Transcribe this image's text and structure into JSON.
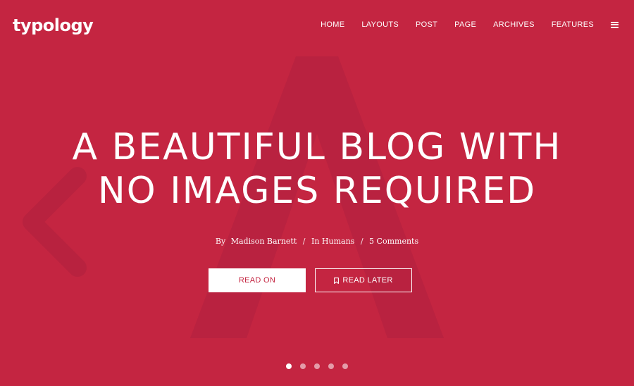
{
  "brand": {
    "logo": "typology",
    "accent_color": "#c42541"
  },
  "nav": {
    "items": [
      "HOME",
      "LAYOUTS",
      "POST",
      "PAGE",
      "ARCHIVES",
      "FEATURES"
    ],
    "menu_icon": "hamburger-icon"
  },
  "hero": {
    "background_letter": "A",
    "title_line1": "A BEAUTIFUL BLOG WITH",
    "title_line2": "NO IMAGES REQUIRED",
    "meta": {
      "by_label": "By",
      "author": "Madison Barnett",
      "sep1": "/",
      "category_prefix": "In",
      "category": "Humans",
      "sep2": "/",
      "comments": "5 Comments"
    },
    "buttons": {
      "read_on": "READ ON",
      "read_later": "READ LATER",
      "read_later_icon": "bookmark-icon"
    }
  },
  "slider": {
    "slides": 5,
    "active_index": 0
  }
}
